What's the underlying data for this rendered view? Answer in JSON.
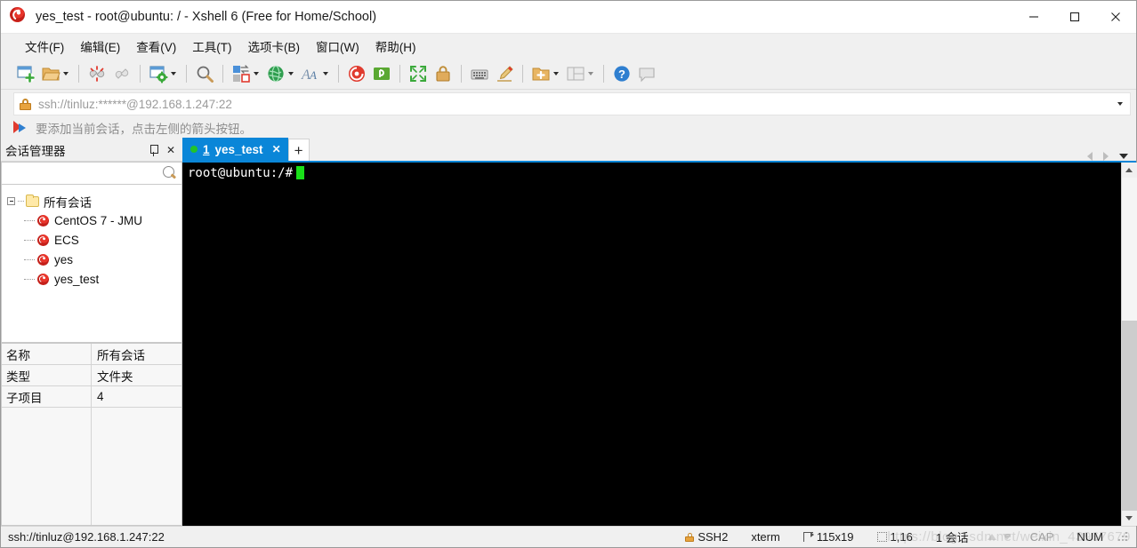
{
  "window": {
    "title": "yes_test - root@ubuntu: / - Xshell 6 (Free for Home/School)",
    "app_icon": "xshell-logo-icon",
    "minimize_label": "—",
    "maximize_label": "☐",
    "close_label": "✕"
  },
  "menubar": {
    "items": [
      {
        "label": "文件(F)",
        "name": "menu-file"
      },
      {
        "label": "编辑(E)",
        "name": "menu-edit"
      },
      {
        "label": "查看(V)",
        "name": "menu-view"
      },
      {
        "label": "工具(T)",
        "name": "menu-tools"
      },
      {
        "label": "选项卡(B)",
        "name": "menu-tabs"
      },
      {
        "label": "窗口(W)",
        "name": "menu-window"
      },
      {
        "label": "帮助(H)",
        "name": "menu-help"
      }
    ]
  },
  "toolbar": {
    "icons": [
      "new-session-icon",
      "open-folder-icon",
      "disconnect-icon",
      "link-icon",
      "session-properties-icon",
      "find-icon",
      "transfer-file-icon",
      "globe-icon",
      "font-icon",
      "xshell-icon",
      "xftp-icon",
      "fullscreen-icon",
      "lock-screen-icon",
      "keyboard-icon",
      "highlight-pen-icon",
      "new-folder-icon",
      "layout-icon",
      "help-icon",
      "chat-icon"
    ]
  },
  "address_bar": {
    "lock_icon": "lock-icon",
    "value": "ssh://tinluz:******@192.168.1.247:22",
    "dropdown_icon": "chevron-down-icon"
  },
  "hint": {
    "icon": "add-session-arrow-icon",
    "text": "要添加当前会话，点击左侧的箭头按钮。"
  },
  "session_manager": {
    "title": "会话管理器",
    "pin_icon": "pin-icon",
    "close_icon": "close-icon",
    "search": {
      "value": "",
      "placeholder": "",
      "icon": "search-icon"
    },
    "tree": {
      "root": {
        "label": "所有会话",
        "icon": "folder-icon",
        "expanded": true
      },
      "children": [
        {
          "label": "CentOS 7 - JMU",
          "icon": "session-icon"
        },
        {
          "label": "ECS",
          "icon": "session-icon"
        },
        {
          "label": "yes",
          "icon": "session-icon"
        },
        {
          "label": "yes_test",
          "icon": "session-icon"
        }
      ]
    },
    "properties": [
      {
        "key": "名称",
        "value": "所有会话"
      },
      {
        "key": "类型",
        "value": "文件夹"
      },
      {
        "key": "子项目",
        "value": "4"
      }
    ]
  },
  "tabs": {
    "active": {
      "status_icon": "connected-dot-icon",
      "index": "1",
      "label": "yes_test",
      "close_icon": "close-icon"
    },
    "new_tab_label": "+",
    "nav_prev_icon": "chevron-left-icon",
    "nav_next_icon": "chevron-right-icon",
    "nav_list_icon": "chevron-down-icon"
  },
  "terminal": {
    "prompt": "root@ubuntu:/#",
    "cursor": "block-cursor",
    "scrollbar": {
      "up_icon": "chevron-up-icon",
      "down_icon": "chevron-down-icon"
    }
  },
  "statusbar": {
    "connection": "ssh://tinluz@192.168.1.247:22",
    "protocol_icon": "lock-icon",
    "protocol": "SSH2",
    "terminal_type": "xterm",
    "size_icon": "terminal-size-icon",
    "size": "115x19",
    "cursor_icon": "cursor-position-icon",
    "cursor_pos": "1,16",
    "sessions": "1 会话",
    "up_icon": "arrow-up-icon",
    "down_icon": "arrow-down-icon",
    "caps": "CAP",
    "num": "NUM"
  },
  "watermark": "https://blog.csdn.net/weixin_43967679",
  "colors": {
    "accent": "#0a86d8",
    "connected": "#22c32a",
    "terminal_bg": "#000000",
    "terminal_fg": "#ffffff",
    "cursor": "#19e019",
    "chrome": "#f0f0f0"
  }
}
